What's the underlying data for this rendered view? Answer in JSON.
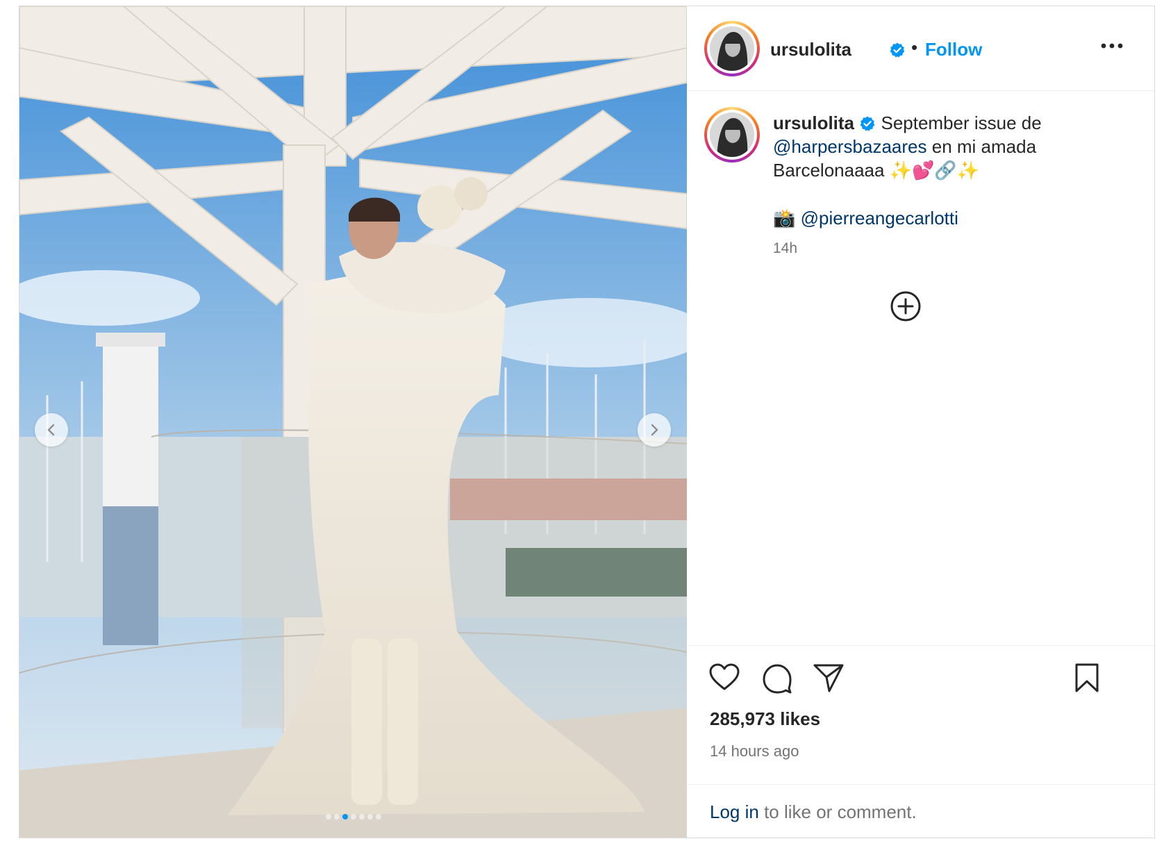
{
  "post": {
    "author": {
      "username": "ursulolita",
      "verified": true,
      "avatar": "profile-photo"
    },
    "header": {
      "separator": "•",
      "follow_label": "Follow",
      "more_icon": "more-horizontal-icon"
    },
    "caption": {
      "text_line1": "September issue de",
      "mention1": "@harpersbazaares",
      "text_line2": "en mi amada",
      "text_line3": "Barcelonaaaa ✨💕🔗✨",
      "credit_emoji": "📸",
      "credit_mention": "@pierreangecarlotti",
      "timestamp": "14h"
    },
    "load_more_icon": "plus-circle-icon",
    "actions": {
      "like_icon": "heart-icon",
      "comment_icon": "comment-icon",
      "share_icon": "send-icon",
      "save_icon": "bookmark-icon"
    },
    "likes_text": "285,973 likes",
    "posted_ago": "14 hours ago",
    "login_prompt": {
      "link": "Log in",
      "rest": "to like or comment."
    },
    "carousel": {
      "prev_icon": "chevron-left-icon",
      "next_icon": "chevron-right-icon",
      "total_slides": 7,
      "active_slide": 3
    },
    "colors": {
      "accent": "#0095f6",
      "link": "#00376b",
      "muted": "#737373",
      "text": "#262626"
    }
  }
}
